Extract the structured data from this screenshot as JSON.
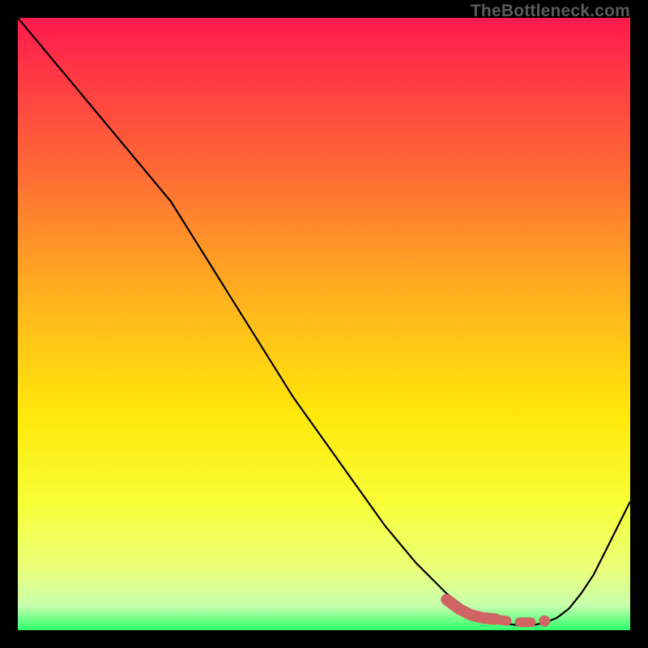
{
  "watermark": "TheBottleneck.com",
  "chart_data": {
    "type": "line",
    "title": "",
    "xlabel": "",
    "ylabel": "",
    "xlim": [
      0,
      100
    ],
    "ylim": [
      0,
      100
    ],
    "grid": false,
    "legend": false,
    "series": [
      {
        "name": "curve",
        "color": "#000000",
        "x": [
          0,
          5,
          10,
          15,
          20,
          25,
          30,
          35,
          40,
          45,
          50,
          55,
          60,
          65,
          70,
          74,
          78,
          80,
          82,
          84,
          86,
          88,
          90,
          92,
          94,
          96,
          98,
          100
        ],
        "y": [
          100,
          94,
          88,
          82,
          76,
          70,
          62,
          54,
          46,
          38,
          31,
          24,
          17,
          11,
          6,
          3,
          1.5,
          1,
          0.8,
          0.8,
          1.2,
          2,
          3.5,
          6,
          9,
          13,
          17,
          21
        ]
      },
      {
        "name": "optimal-band",
        "color": "#d06464",
        "style": "thick-dashed",
        "x": [
          70,
          72,
          74,
          76,
          78,
          80,
          82,
          84,
          86
        ],
        "y": [
          5,
          3.5,
          2.5,
          2,
          1.8,
          1.5,
          1.3,
          1.3,
          1.5
        ]
      }
    ],
    "background_gradient": {
      "type": "vertical",
      "stops": [
        {
          "pos": 0.0,
          "color": "#ff1a4e"
        },
        {
          "pos": 0.25,
          "color": "#ff6a35"
        },
        {
          "pos": 0.45,
          "color": "#ffb01f"
        },
        {
          "pos": 0.65,
          "color": "#ffe80a"
        },
        {
          "pos": 0.8,
          "color": "#f7ff3a"
        },
        {
          "pos": 0.9,
          "color": "#eaff7a"
        },
        {
          "pos": 0.96,
          "color": "#c8ffad"
        },
        {
          "pos": 1.0,
          "color": "#2dff6b"
        }
      ]
    }
  }
}
